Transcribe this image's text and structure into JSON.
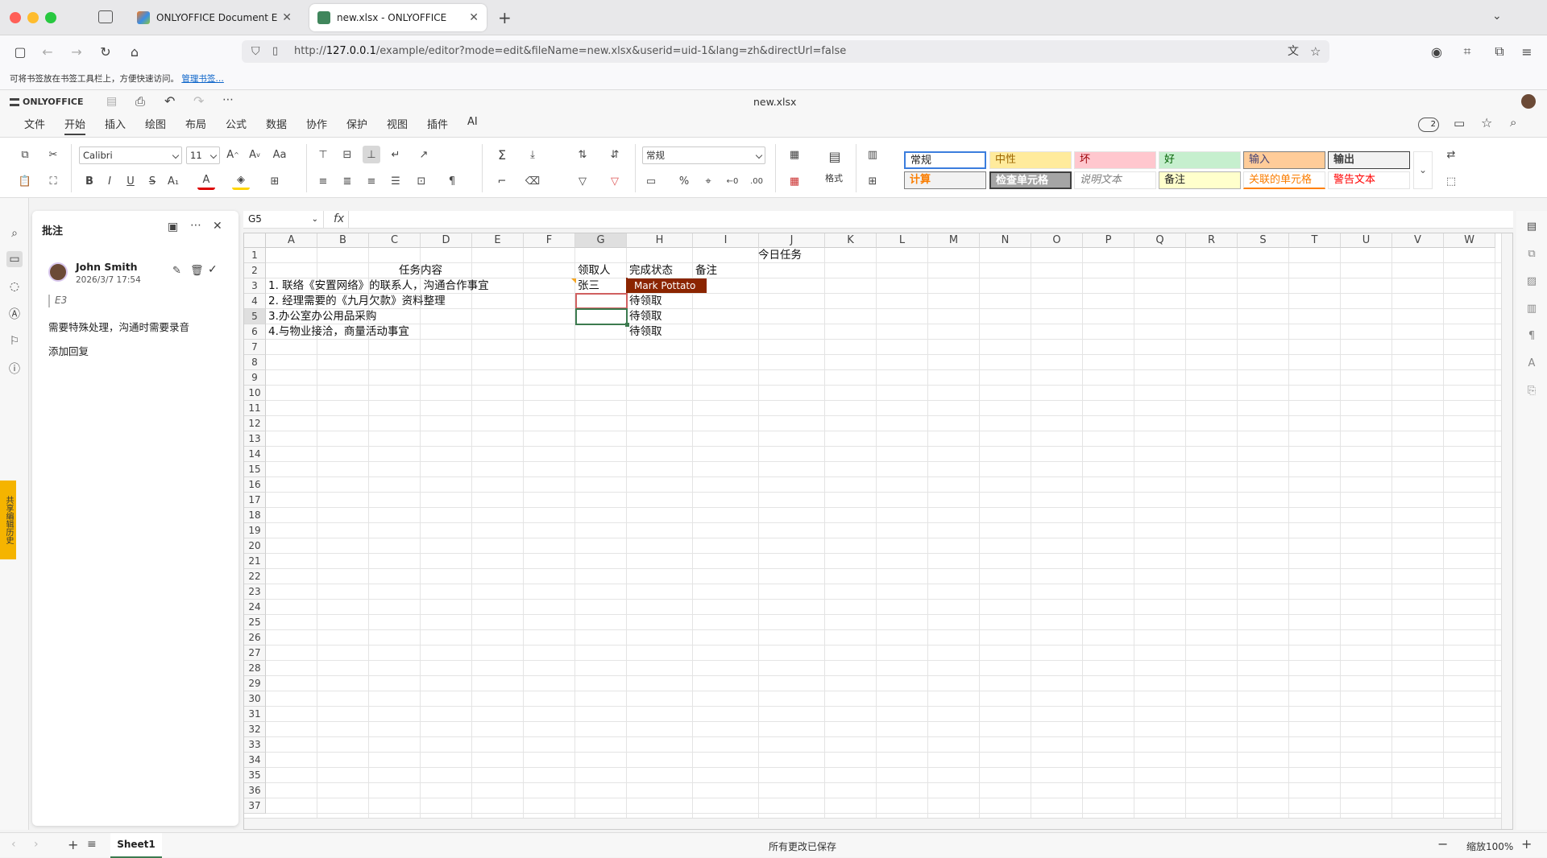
{
  "browser": {
    "tabs": [
      {
        "label": "ONLYOFFICE Document Editors",
        "active": false
      },
      {
        "label": "new.xlsx - ONLYOFFICE",
        "active": true
      }
    ],
    "url_prefix": "http://",
    "url_host": "127.0.0.1",
    "url_path": "/example/editor?mode=edit&fileName=new.xlsx&userid=uid-1&lang=zh&directUrl=false",
    "bookmark_hint": "可将书签放在书签工具栏上，方便快速访问。",
    "bookmark_link": "管理书签…"
  },
  "app": {
    "brand": "ONLYOFFICE",
    "doc_title": "new.xlsx",
    "menu_tabs": [
      "文件",
      "开始",
      "插入",
      "绘图",
      "布局",
      "公式",
      "数据",
      "协作",
      "保护",
      "视图",
      "插件",
      "AI"
    ],
    "active_tab": "开始",
    "user_count": "2"
  },
  "ribbon": {
    "font_name": "Calibri",
    "font_size": "11",
    "number_format": "常规",
    "format_label": "格式",
    "cell_styles_row1": [
      {
        "label": "常规",
        "bg": "#ffffff",
        "fg": "#000000"
      },
      {
        "label": "中性",
        "bg": "#ffeb9c",
        "fg": "#9c6500"
      },
      {
        "label": "坏",
        "bg": "#ffc7ce",
        "fg": "#9c0006"
      },
      {
        "label": "好",
        "bg": "#c6efce",
        "fg": "#006100"
      },
      {
        "label": "输入",
        "bg": "#ffcc99",
        "fg": "#3f3f76"
      },
      {
        "label": "输出",
        "bg": "#f2f2f2",
        "fg": "#3f3f3f"
      }
    ],
    "cell_styles_row2": [
      {
        "label": "计算",
        "bg": "#f2f2f2",
        "fg": "#fa7d00"
      },
      {
        "label": "检查单元格",
        "bg": "#a5a5a5",
        "fg": "#ffffff"
      },
      {
        "label": "说明文本",
        "bg": "#ffffff",
        "fg": "#7f7f7f"
      },
      {
        "label": "备注",
        "bg": "#ffffcc",
        "fg": "#000000"
      },
      {
        "label": "关联的单元格",
        "bg": "#ffffff",
        "fg": "#fa7d00"
      },
      {
        "label": "警告文本",
        "bg": "#ffffff",
        "fg": "#ff0000"
      }
    ]
  },
  "comments": {
    "title": "批注",
    "author": "John Smith",
    "date": "2026/3/7 17:54",
    "cell_ref": "E3",
    "text": "需要特殊处理，沟通时需要录音",
    "reply": "添加回复"
  },
  "side_tab": "共享编辑历史",
  "formula_bar": {
    "name_box": "G5",
    "fx": "fx",
    "content": ""
  },
  "grid": {
    "columns": [
      "A",
      "B",
      "C",
      "D",
      "E",
      "F",
      "G",
      "H",
      "I",
      "J",
      "K",
      "L",
      "M",
      "N",
      "O",
      "P",
      "Q",
      "R",
      "S",
      "T",
      "U",
      "V",
      "W"
    ],
    "rows": [
      "1",
      "2",
      "3",
      "4",
      "5",
      "6",
      "7",
      "8",
      "9",
      "10",
      "11",
      "12",
      "13",
      "14",
      "15",
      "16",
      "17",
      "18",
      "19",
      "20",
      "21",
      "22",
      "23",
      "24",
      "25",
      "26",
      "27",
      "28",
      "29",
      "30",
      "31",
      "32",
      "33",
      "34",
      "35",
      "36",
      "37"
    ],
    "selected_col": "G",
    "selected_row": "5",
    "cells": {
      "title": "今日任务",
      "h_task": "任务内容",
      "h_owner": "领取人",
      "h_status": "完成状态",
      "h_note": "备注",
      "t1": "1. 联络《安置网络》的联系人，沟通合作事宜",
      "t2": "2. 经理需要的《九月欠款》资料整理",
      "t3": "3.办公室办公用品采购",
      "t4": "4.与物业接洽，商量活动事宜",
      "o1": "张三",
      "s2": "待领取",
      "s3": "待领取",
      "s4": "待领取"
    },
    "presence_user": "Mark Pottato",
    "presence_color": "#8b2500"
  },
  "status": {
    "sheet": "Sheet1",
    "save_text": "所有更改已保存",
    "zoom": "缩放100%"
  }
}
